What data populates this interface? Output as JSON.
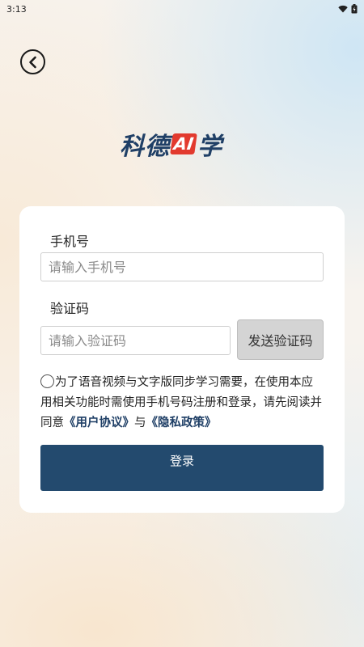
{
  "status_bar": {
    "time": "3:13",
    "wifi_icon": "wifi-icon",
    "battery_icon": "battery-icon"
  },
  "header": {
    "back_icon": "chevron-left-icon"
  },
  "logo": {
    "text_left": "科德",
    "text_ai": "AI",
    "text_right": "学",
    "colors": {
      "text": "#1f3f66",
      "ai_badge": "#e23a2e"
    }
  },
  "form": {
    "phone_label": "手机号",
    "phone_placeholder": "请输入手机号",
    "phone_value": "",
    "code_label": "验证码",
    "code_placeholder": "请输入验证码",
    "code_value": "",
    "send_code_label": "发送验证码",
    "agreement": {
      "text_before": "为了语音视频与文字版同步学习需要，在使用本应用相关功能时需使用手机号码注册和登录，请先阅读并同意",
      "user_agreement": "《用户协议》",
      "conjunction": "与",
      "privacy_policy": "《隐私政策》",
      "checked": false
    },
    "login_label": "登录"
  },
  "colors": {
    "primary": "#234a6e",
    "send_button_bg": "#d4d4d4"
  }
}
